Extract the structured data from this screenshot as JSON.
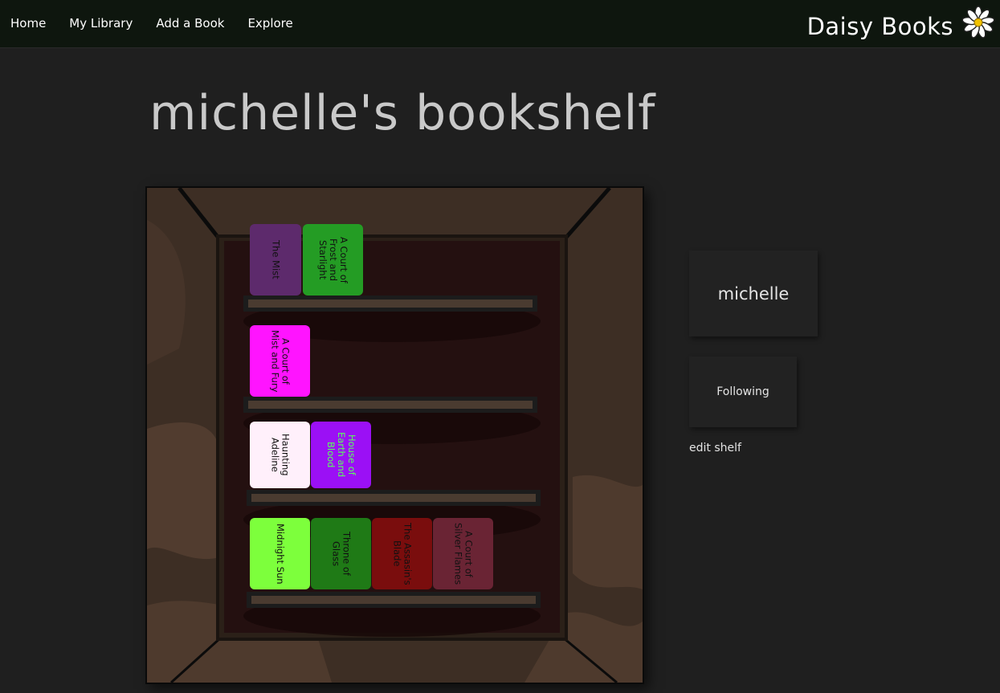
{
  "nav": {
    "links": [
      "Home",
      "My Library",
      "Add a Book",
      "Explore"
    ],
    "brand": "Daisy Books",
    "brand_icon": "daisy-icon"
  },
  "page": {
    "title": "michelle's bookshelf"
  },
  "shelves": [
    {
      "books": [
        {
          "title": "The Mist",
          "color": "#5d2a6c",
          "text_color": "#111111"
        },
        {
          "title": "A Court of Frost and Starlight",
          "color": "#249c24",
          "text_color": "#111111"
        }
      ]
    },
    {
      "books": [
        {
          "title": "A Court of Mist and Fury",
          "color": "#ff14ff",
          "text_color": "#111111"
        }
      ]
    },
    {
      "books": [
        {
          "title": "Haunting Adeline",
          "color": "#fff0fb",
          "text_color": "#111111"
        },
        {
          "title": "House of Earth and Blood",
          "color": "#9b10f5",
          "text_color": "#5cff5c"
        }
      ]
    },
    {
      "books": [
        {
          "title": "Midnight Sun",
          "color": "#7dff3c",
          "text_color": "#111111"
        },
        {
          "title": "Throne of Glass",
          "color": "#1f7a16",
          "text_color": "#111111"
        },
        {
          "title": "The Assasin's Blade",
          "color": "#7a0d0d",
          "text_color": "#111111"
        },
        {
          "title": "A Court of Silver Flames",
          "color": "#6a2434",
          "text_color": "#111111"
        }
      ]
    }
  ],
  "sidebar": {
    "username": "michelle",
    "follow_label": "Following",
    "edit_label": "edit shelf"
  }
}
